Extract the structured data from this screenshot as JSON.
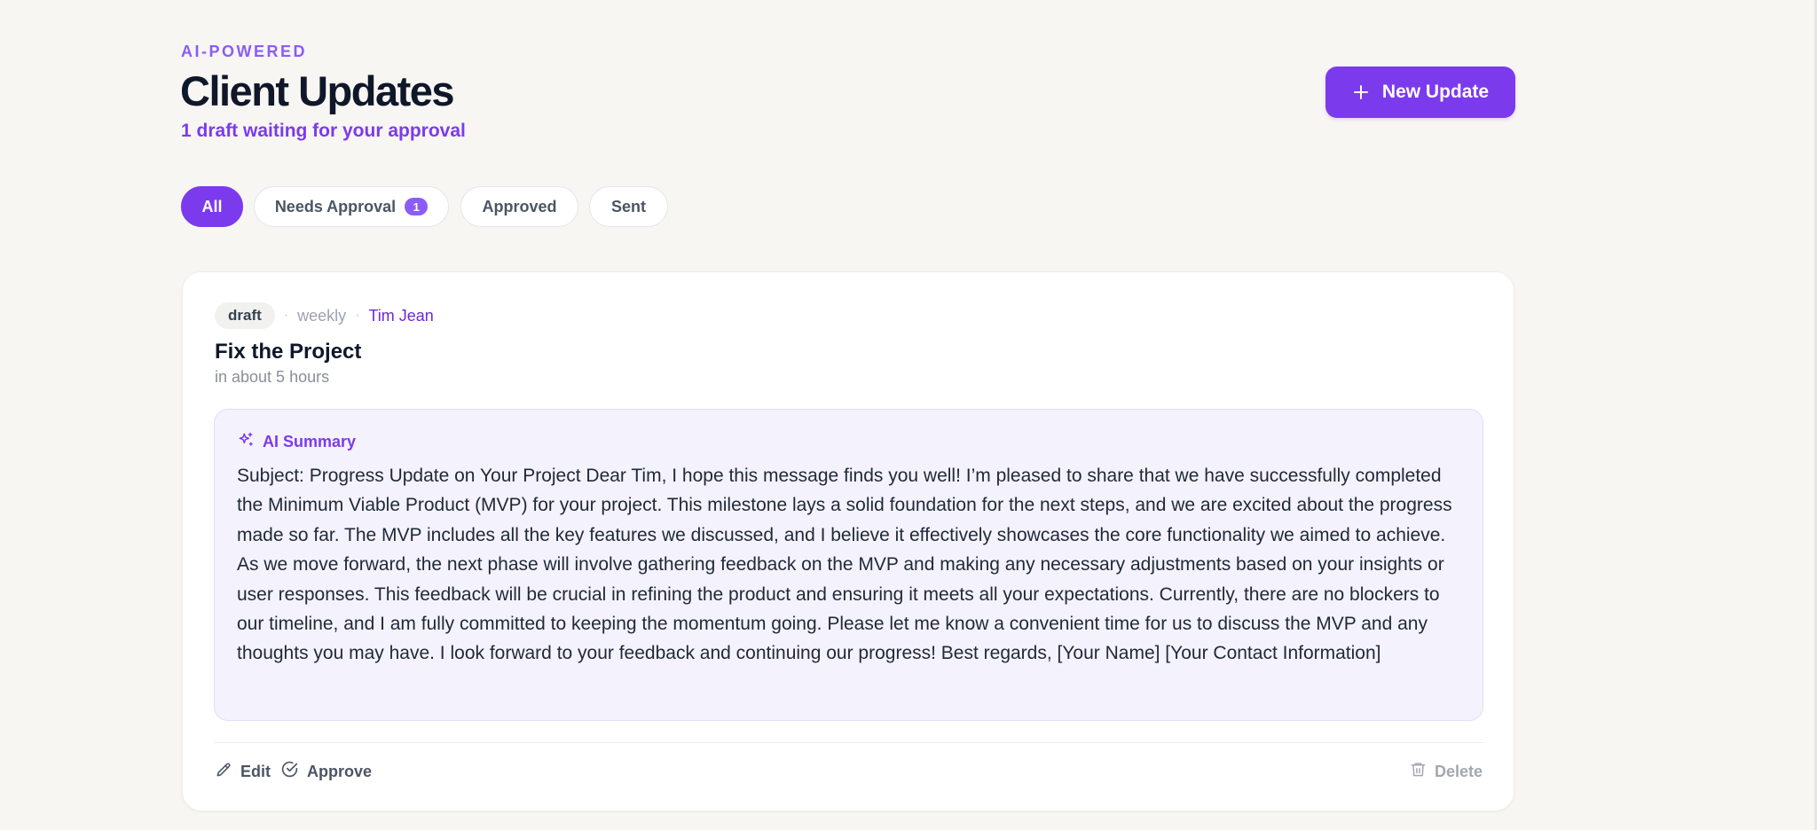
{
  "header": {
    "eyebrow": "AI-POWERED",
    "title": "Client Updates",
    "subtitle": "1 draft waiting for your approval",
    "new_button_label": "New Update"
  },
  "filters": {
    "tabs": [
      {
        "label": "All",
        "active": true
      },
      {
        "label": "Needs Approval",
        "badge": "1",
        "active": false
      },
      {
        "label": "Approved",
        "active": false
      },
      {
        "label": "Sent",
        "active": false
      }
    ]
  },
  "update": {
    "status": "draft",
    "frequency": "weekly",
    "client": "Tim Jean",
    "title": "Fix the Project",
    "time": "in about 5 hours",
    "ai_summary_label": "AI Summary",
    "ai_summary_text": "Subject: Progress Update on Your Project Dear Tim, I hope this message finds you well! I’m pleased to share that we have successfully completed the Minimum Viable Product (MVP) for your project. This milestone lays a solid foundation for the next steps, and we are excited about the progress made so far. The MVP includes all the key features we discussed, and I believe it effectively showcases the core functionality we aimed to achieve. As we move forward, the next phase will involve gathering feedback on the MVP and making any necessary adjustments based on your insights or user responses. This feedback will be crucial in refining the product and ensuring it meets all your expectations. Currently, there are no blockers to our timeline, and I am fully committed to keeping the momentum going. Please let me know a convenient time for us to discuss the MVP and any thoughts you may have. I look forward to your feedback and continuing our progress! Best regards, [Your Name] [Your Contact Information]",
    "actions": {
      "edit": "Edit",
      "approve": "Approve",
      "delete": "Delete"
    }
  },
  "colors": {
    "accent": "#7c3aed",
    "accent_light": "#8b5cf6",
    "background": "#f7f6f3",
    "summary_bg": "#f4f2fd"
  }
}
